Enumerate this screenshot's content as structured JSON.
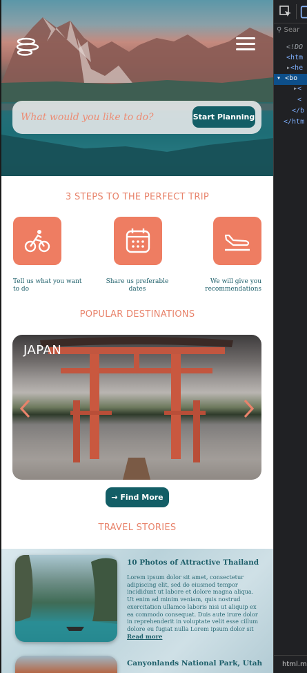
{
  "hero": {
    "search_placeholder": "What would you like to do?",
    "start_button": "Start Planning"
  },
  "steps": {
    "title": "3 STEPS TO THE PERFECT TRIP",
    "items": [
      {
        "icon": "bicycle-rider-icon",
        "text": "Tell us what you want to do"
      },
      {
        "icon": "calendar-icon",
        "text": "Share us preferable dates"
      },
      {
        "icon": "airplane-landing-icon",
        "text": "We will give you recommendations"
      }
    ]
  },
  "destinations": {
    "title": "POPULAR DESTINATIONS",
    "current": "JAPAN",
    "find_more": "Find More"
  },
  "stories": {
    "title": "TRAVEL STORIES",
    "items": [
      {
        "title": "10 Photos of Attractive Thailand",
        "body": "Lorem ipsum dolor sit amet, consectetur adipiscing elit, sed do eiusmod tempor incididunt ut labore et dolore magna aliqua. Ut enim ad minim veniam, quis nostrud exercitation ullamco laboris nisi ut aliquip ex ea commodo consequat. Duis aute irure dolor in reprehenderit in voluptate velit esse cillum dolore eu fugiat nulla Lorem ipsum dolor sit a...",
        "read_more": "Read more"
      },
      {
        "title": "Canyonlands National Park, Utah"
      }
    ]
  },
  "devtools": {
    "search": "Sear",
    "lines": [
      "<!DO",
      "<htm",
      "<he",
      "<bo",
      "<",
      "<",
      "</b",
      "</htm"
    ],
    "status": "html.m"
  },
  "colors": {
    "accent": "#e8836b",
    "primary": "#135e66",
    "text_teal": "#1e5f6a"
  }
}
